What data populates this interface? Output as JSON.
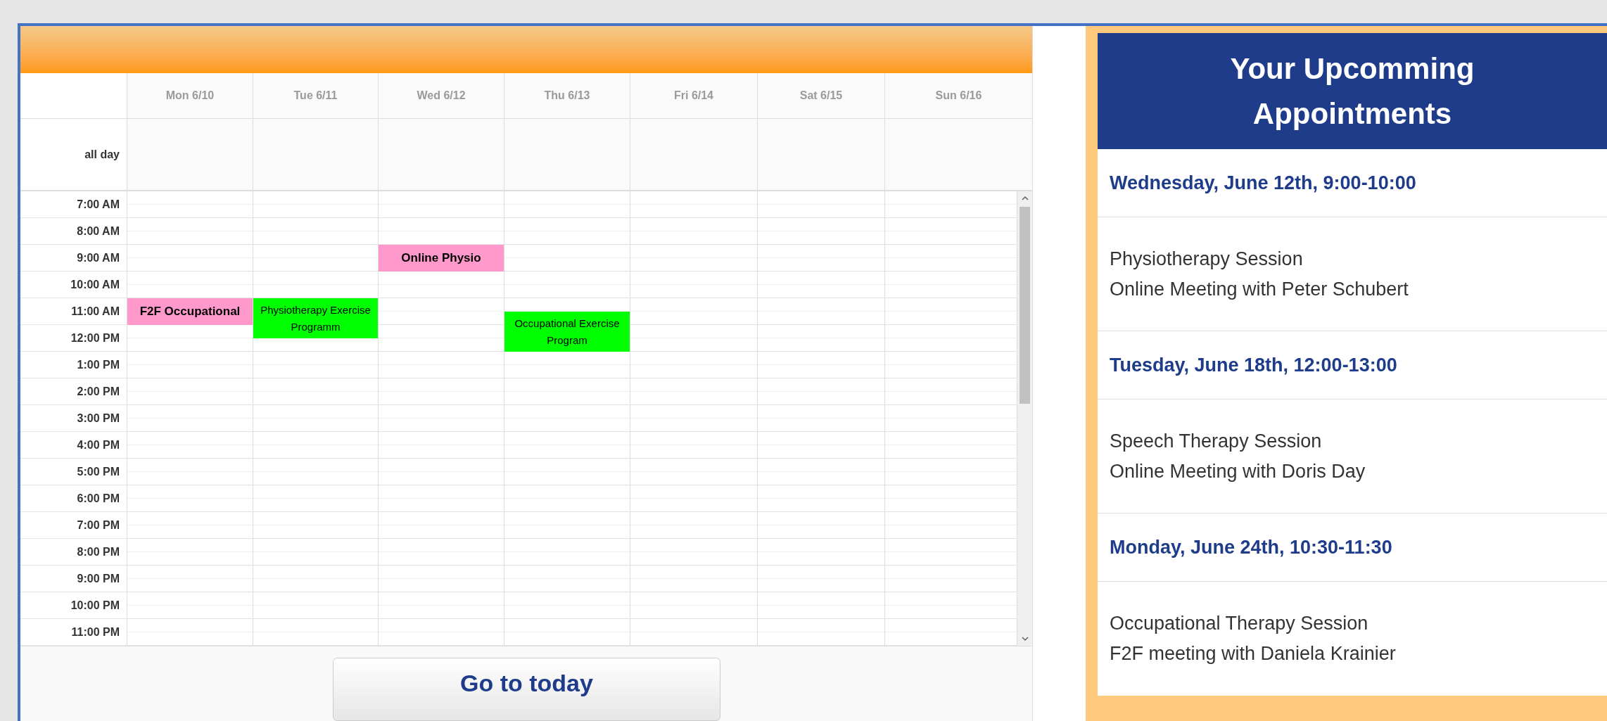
{
  "calendar": {
    "all_day_label": "all day",
    "days": [
      "Mon 6/10",
      "Tue 6/11",
      "Wed 6/12",
      "Thu 6/13",
      "Fri 6/14",
      "Sat 6/15",
      "Sun 6/16"
    ],
    "hours": [
      {
        "label": "7:00 AM"
      },
      {
        "label": "8:00 AM"
      },
      {
        "label": "9:00 AM",
        "cells": [
          null,
          null,
          {
            "title": "Online Physio",
            "half_past": false,
            "color": "#ff99cc",
            "kind": "hour"
          }
        ]
      },
      {
        "label": "10:00 AM"
      },
      {
        "label": "11:00 AM",
        "cells": [
          {
            "title": "F2F Occupational",
            "half_past": false,
            "color": "#ff99cc",
            "kind": "hour"
          },
          {
            "title": "Physiotherapy Exercise Programm",
            "half_past": false,
            "color": "#00ff00",
            "kind": "long"
          },
          null,
          {
            "title": "Occupational Exercise Program",
            "half_past": true,
            "color": "#00ff00",
            "kind": "long"
          }
        ]
      },
      {
        "label": "12:00 PM"
      },
      {
        "label": "1:00 PM"
      },
      {
        "label": "2:00 PM"
      },
      {
        "label": "3:00 PM"
      },
      {
        "label": "4:00 PM"
      },
      {
        "label": "5:00 PM"
      },
      {
        "label": "6:00 PM"
      },
      {
        "label": "7:00 PM"
      },
      {
        "label": "8:00 PM"
      },
      {
        "label": "9:00 PM"
      },
      {
        "label": "10:00 PM"
      },
      {
        "label": "11:00 PM"
      }
    ],
    "today_button": "Go to today"
  },
  "appointments": {
    "title": "Your Upcomming Appointments",
    "items": [
      {
        "when": "Wednesday, June 12th, 9:00-10:00",
        "lines": [
          "Physiotherapy Session",
          "Online Meeting with Peter Schubert"
        ]
      },
      {
        "when": "Tuesday, June 18th, 12:00-13:00",
        "lines": [
          "Speech Therapy Session",
          "Online Meeting with Doris Day"
        ]
      },
      {
        "when": "Monday, June 24th, 10:30-11:30",
        "lines": [
          "Occupational Therapy Session",
          "F2F meeting with Daniela Krainier"
        ]
      }
    ]
  }
}
